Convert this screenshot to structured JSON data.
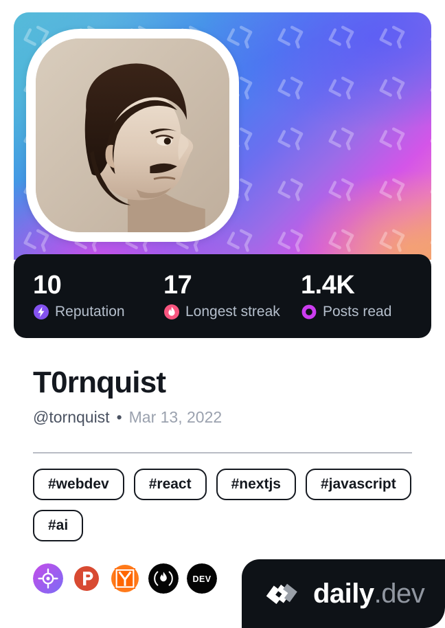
{
  "card": {
    "type": "devcard",
    "brand_name_primary": "daily",
    "brand_name_secondary": ".dev",
    "brand_logo_icon": "daily-dev-chevron-logo"
  },
  "cover": {
    "gradient_from": "#3fb2d4",
    "gradient_mid": "#4a7ef0",
    "gradient_to": "#f0a070",
    "pattern_icon": "daily-dev-chevron-watermark"
  },
  "avatar": {
    "alt": "Profile photo of T0rnquist, sepia portrait in profile",
    "icon": "user-avatar"
  },
  "stats": [
    {
      "value": "10",
      "label": "Reputation",
      "icon": "reputation-bolt-icon",
      "color": "#8452f0"
    },
    {
      "value": "17",
      "label": "Longest streak",
      "icon": "streak-flame-icon",
      "color": "#f8557f"
    },
    {
      "value": "1.4K",
      "label": "Posts read",
      "icon": "posts-read-ring-icon",
      "color": "#cc3df0"
    }
  ],
  "profile": {
    "name": "T0rnquist",
    "handle": "@tornquist",
    "separator": "•",
    "joined_date": "Mar 13, 2022"
  },
  "tags": [
    "#webdev",
    "#react",
    "#nextjs",
    "#javascript",
    "#ai"
  ],
  "socials": [
    {
      "name": "codepen-target-icon",
      "color": "#a45cf0"
    },
    {
      "name": "product-hunt-icon",
      "color": "#d84a32"
    },
    {
      "name": "hacker-news-icon",
      "color": "#ff6600"
    },
    {
      "name": "hashnode-flame-icon",
      "color": "#000000"
    },
    {
      "name": "dev-to-icon",
      "color": "#000000"
    }
  ]
}
